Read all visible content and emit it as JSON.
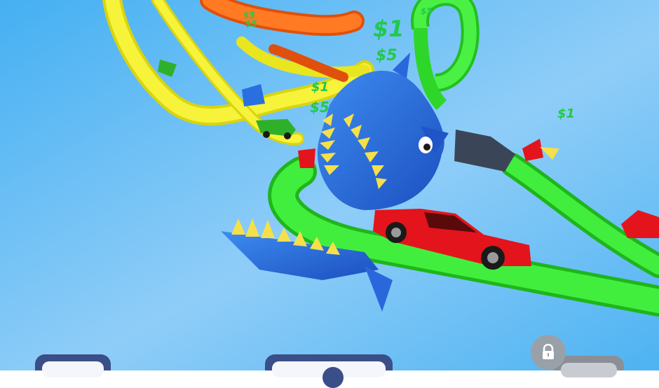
{
  "money_popups": [
    {
      "id": "p1",
      "text": "$1"
    },
    {
      "id": "p2",
      "text": "$5"
    },
    {
      "id": "p3",
      "text": "$1"
    },
    {
      "id": "p4",
      "text": "$5"
    },
    {
      "id": "p5",
      "text": "$1"
    },
    {
      "id": "p6",
      "text": "$5"
    },
    {
      "id": "p7",
      "text": "$5"
    },
    {
      "id": "p8",
      "text": "$5"
    }
  ],
  "colors": {
    "sky_top": "#3aa7ef",
    "sky_bottom": "#a9dcfb",
    "track_yellow": "#f4ef2a",
    "track_green": "#3ee83a",
    "track_orange": "#ff6a1a",
    "shark_blue": "#2a6fe0",
    "car_red": "#e4141c",
    "money_green": "#22c94a",
    "button_frame": "#3a4e88"
  },
  "bottom_bar": {
    "left_button": {
      "icon": "menu-icon"
    },
    "center_button": {
      "icon": "add-icon"
    },
    "right_button": {
      "icon": "lock-icon",
      "locked": true
    }
  }
}
